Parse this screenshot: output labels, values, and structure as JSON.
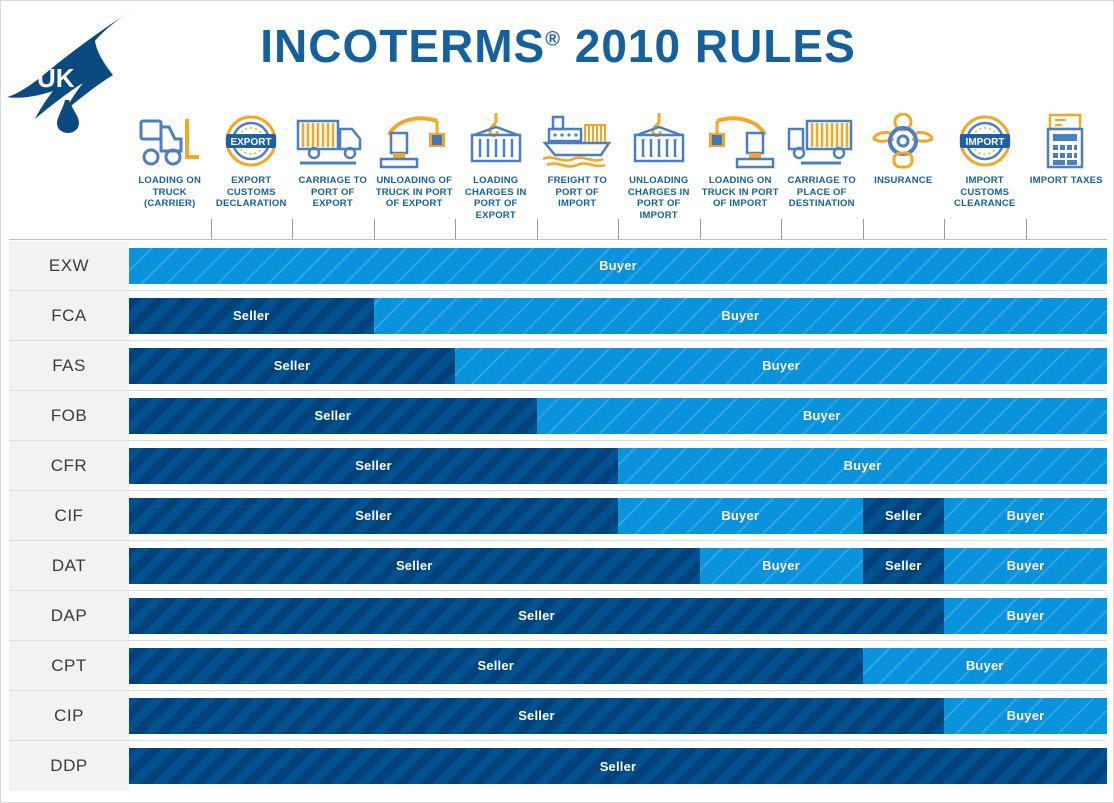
{
  "header": {
    "title": "INCOTERMS",
    "title_sup": "®",
    "title_rest": " 2010 RULES",
    "logo_text": "UK",
    "columns": [
      {
        "id": "loading-on-truck",
        "icon": "forklift-icon",
        "label": "LOADING ON TRUCK (CARRIER)"
      },
      {
        "id": "export-customs-declaration",
        "icon": "export-stamp-icon",
        "label": "EXPORT CUSTOMS DECLARATION"
      },
      {
        "id": "carriage-to-port-of-export",
        "icon": "truck-icon",
        "label": "CARRIAGE TO PORT OF EXPORT"
      },
      {
        "id": "unloading-of-truck-in-port-of-export",
        "icon": "crane-unload-icon",
        "label": "UNLOADING OF TRUCK IN PORT OF EXPORT"
      },
      {
        "id": "loading-charges-in-port-of-export",
        "icon": "container-hook-icon",
        "label": "LOADING CHARGES IN PORT OF EXPORT"
      },
      {
        "id": "freight-to-port-of-import",
        "icon": "cargo-ship-icon",
        "label": "FREIGHT TO PORT OF IMPORT"
      },
      {
        "id": "unloading-charges-in-port-of-import",
        "icon": "container-hook-icon",
        "label": "UNLOADING CHARGES IN PORT OF IMPORT"
      },
      {
        "id": "loading-on-truck-in-port-of-import",
        "icon": "crane-load-icon",
        "label": "LOADING ON TRUCK IN PORT OF IMPORT"
      },
      {
        "id": "carriage-to-place-of-destination",
        "icon": "truck-icon",
        "label": "CARRIAGE TO PLACE OF DESTINATION"
      },
      {
        "id": "insurance",
        "icon": "lifebuoy-person-icon",
        "label": "INSURANCE"
      },
      {
        "id": "import-customs-clearance",
        "icon": "import-stamp-icon",
        "label": "IMPORT CUSTOMS CLEARANCE"
      },
      {
        "id": "import-taxes",
        "icon": "calculator-receipt-icon",
        "label": "IMPORT TAXES"
      }
    ]
  },
  "legend": {
    "seller": "Seller",
    "buyer": "Buyer"
  },
  "colors": {
    "title_blue": "#14619e",
    "seller_blue": "#00518f",
    "buyer_blue": "#0a93dd",
    "label_bg": "#f2f2f2",
    "label_text": "#3b3b3b"
  },
  "chart_data": {
    "type": "bar",
    "title": "INCOTERMS® 2010 RULES",
    "categories": [
      "LOADING ON TRUCK (CARRIER)",
      "EXPORT CUSTOMS DECLARATION",
      "CARRIAGE TO PORT OF EXPORT",
      "UNLOADING OF TRUCK IN PORT OF EXPORT",
      "LOADING CHARGES IN PORT OF EXPORT",
      "FREIGHT TO PORT OF IMPORT",
      "UNLOADING CHARGES IN PORT OF IMPORT",
      "LOADING ON TRUCK IN PORT OF IMPORT",
      "CARRIAGE TO PLACE OF DESTINATION",
      "INSURANCE",
      "IMPORT CUSTOMS CLEARANCE",
      "IMPORT TAXES"
    ],
    "legend": [
      "Seller",
      "Buyer"
    ],
    "total_columns": 12,
    "rows": [
      {
        "term": "EXW",
        "segments": [
          {
            "party": "Buyer",
            "cols": 12,
            "label": "Buyer"
          }
        ]
      },
      {
        "term": "FCA",
        "segments": [
          {
            "party": "Seller",
            "cols": 3,
            "label": "Seller"
          },
          {
            "party": "Buyer",
            "cols": 9,
            "label": "Buyer"
          }
        ]
      },
      {
        "term": "FAS",
        "segments": [
          {
            "party": "Seller",
            "cols": 4,
            "label": "Seller"
          },
          {
            "party": "Buyer",
            "cols": 8,
            "label": "Buyer"
          }
        ]
      },
      {
        "term": "FOB",
        "segments": [
          {
            "party": "Seller",
            "cols": 5,
            "label": "Seller"
          },
          {
            "party": "Buyer",
            "cols": 7,
            "label": "Buyer"
          }
        ]
      },
      {
        "term": "CFR",
        "segments": [
          {
            "party": "Seller",
            "cols": 6,
            "label": "Seller"
          },
          {
            "party": "Buyer",
            "cols": 6,
            "label": "Buyer"
          }
        ]
      },
      {
        "term": "CIF",
        "segments": [
          {
            "party": "Seller",
            "cols": 6,
            "label": "Seller"
          },
          {
            "party": "Buyer",
            "cols": 3,
            "label": "Buyer"
          },
          {
            "party": "Seller",
            "cols": 1,
            "label": "Seller"
          },
          {
            "party": "Buyer",
            "cols": 2,
            "label": "Buyer"
          }
        ]
      },
      {
        "term": "DAT",
        "segments": [
          {
            "party": "Seller",
            "cols": 7,
            "label": "Seller"
          },
          {
            "party": "Buyer",
            "cols": 2,
            "label": "Buyer"
          },
          {
            "party": "Seller",
            "cols": 1,
            "label": "Seller"
          },
          {
            "party": "Buyer",
            "cols": 2,
            "label": "Buyer"
          }
        ]
      },
      {
        "term": "DAP",
        "segments": [
          {
            "party": "Seller",
            "cols": 10,
            "label": "Seller"
          },
          {
            "party": "Buyer",
            "cols": 2,
            "label": "Buyer"
          }
        ]
      },
      {
        "term": "CPT",
        "segments": [
          {
            "party": "Seller",
            "cols": 9,
            "label": "Seller"
          },
          {
            "party": "Buyer",
            "cols": 3,
            "label": "Buyer"
          }
        ]
      },
      {
        "term": "CIP",
        "segments": [
          {
            "party": "Seller",
            "cols": 10,
            "label": "Seller"
          },
          {
            "party": "Buyer",
            "cols": 2,
            "label": "Buyer"
          }
        ]
      },
      {
        "term": "DDP",
        "segments": [
          {
            "party": "Seller",
            "cols": 12,
            "label": "Seller"
          }
        ]
      }
    ]
  }
}
